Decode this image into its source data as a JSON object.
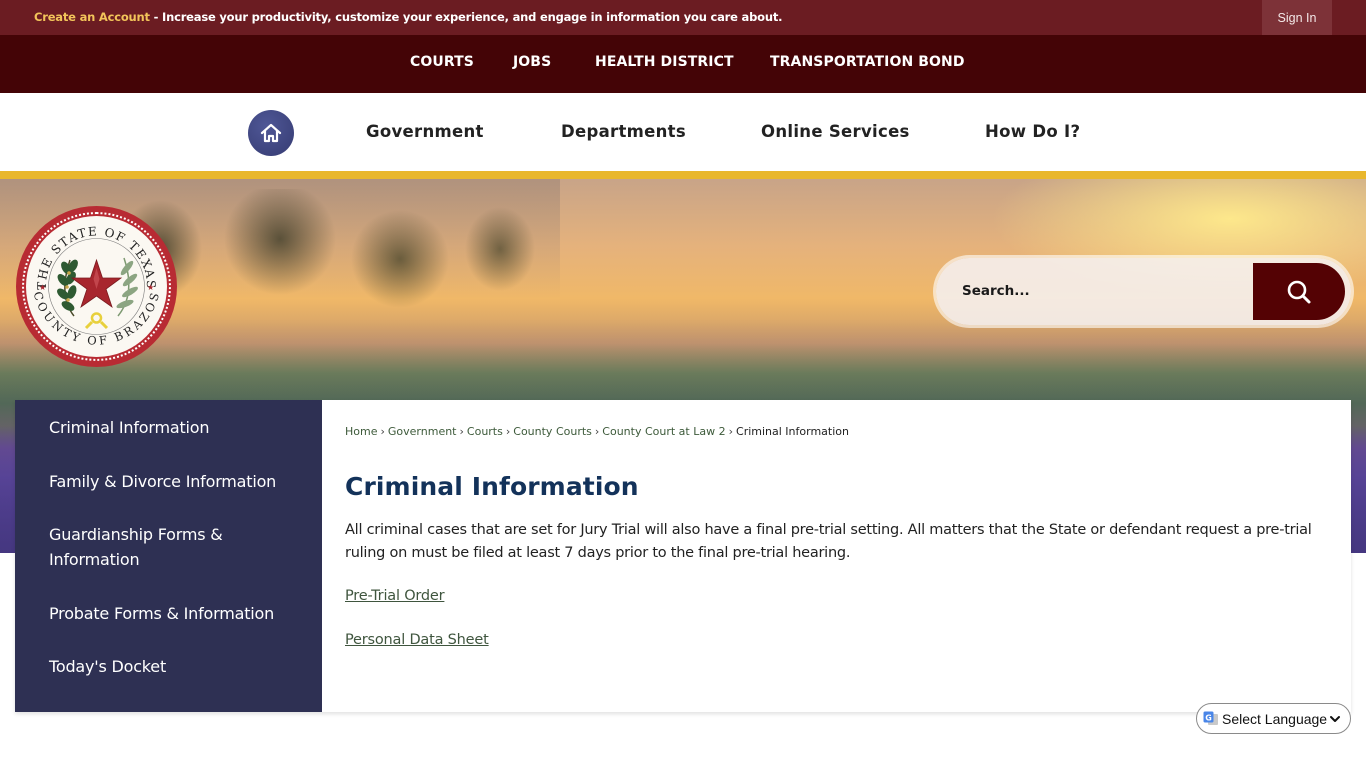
{
  "topbar": {
    "create_account": "Create an Account",
    "promo_text": " - Increase your productivity, customize your experience, and engage in information you care about.",
    "sign_in": "Sign In",
    "colors": {
      "bar": "#6b1c22",
      "accent": "#f2c45a"
    }
  },
  "quicklinks": [
    {
      "label": "COURTS"
    },
    {
      "label": "JOBS"
    },
    {
      "label": "HEALTH DISTRICT"
    },
    {
      "label": "TRANSPORTATION BOND"
    }
  ],
  "mainnav": {
    "home_icon": "home-icon",
    "items": [
      {
        "label": "Government"
      },
      {
        "label": "Departments"
      },
      {
        "label": "Online Services"
      },
      {
        "label": "How Do I?"
      }
    ]
  },
  "seal": {
    "top_text": "THE STATE OF TEXAS",
    "bottom_text": "COUNTY OF BRAZOS"
  },
  "search": {
    "placeholder": "Search...",
    "icon": "search-icon"
  },
  "sidebar": {
    "items": [
      {
        "label": "Criminal Information"
      },
      {
        "label": "Family & Divorce Information"
      },
      {
        "label": "Guardianship Forms & Information"
      },
      {
        "label": "Probate Forms & Information"
      },
      {
        "label": "Today's Docket"
      }
    ]
  },
  "breadcrumb": {
    "items": [
      {
        "label": "Home"
      },
      {
        "label": "Government"
      },
      {
        "label": "Courts"
      },
      {
        "label": "County Courts"
      },
      {
        "label": "County Court at Law 2"
      }
    ],
    "separator": "›",
    "current": "Criminal Information"
  },
  "page": {
    "title": "Criminal Information",
    "paragraph": "All criminal cases that are set for Jury Trial will also have a final pre-trial setting. All matters that the State or defendant request a pre-trial ruling on must be filed at least 7 days prior to the final pre-trial hearing.",
    "links": [
      {
        "label": "Pre-Trial Order"
      },
      {
        "label": "Personal Data Sheet"
      }
    ]
  },
  "language": {
    "selected": "Select Language"
  }
}
